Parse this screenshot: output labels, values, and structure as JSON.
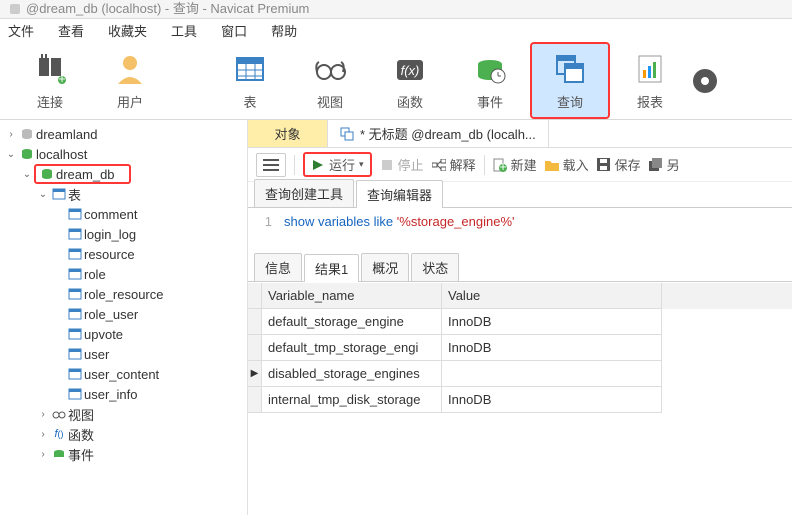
{
  "title_suffix": "@dream_db (localhost) - 查询 - Navicat Premium",
  "menubar": [
    "文件",
    "查看",
    "收藏夹",
    "工具",
    "窗口",
    "帮助"
  ],
  "toolbar": [
    {
      "label": "连接",
      "name": "toolbar-connection"
    },
    {
      "label": "用户",
      "name": "toolbar-user"
    },
    {
      "label": "表",
      "name": "toolbar-tables"
    },
    {
      "label": "视图",
      "name": "toolbar-views"
    },
    {
      "label": "函数",
      "name": "toolbar-functions"
    },
    {
      "label": "事件",
      "name": "toolbar-events"
    },
    {
      "label": "查询",
      "name": "toolbar-query",
      "highlighted": true
    },
    {
      "label": "报表",
      "name": "toolbar-reports"
    }
  ],
  "tree": {
    "conn1": "dreamland",
    "conn2": "localhost",
    "db": "dream_db",
    "tables_label": "表",
    "tables": [
      "comment",
      "login_log",
      "resource",
      "role",
      "role_resource",
      "role_user",
      "upvote",
      "user",
      "user_content",
      "user_info"
    ],
    "views": "视图",
    "functions": "函数",
    "events": "事件"
  },
  "tabs": {
    "objects": "对象",
    "query_title": "* 无标题 @dream_db (localh..."
  },
  "actions": {
    "run": "运行",
    "stop": "停止",
    "explain": "解释",
    "new": "新建",
    "load": "载入",
    "save": "保存",
    "saveas": "另"
  },
  "subtabs": {
    "builder": "查询创建工具",
    "editor": "查询编辑器"
  },
  "sql": {
    "line_no": "1",
    "kw1": "show",
    "kw2": "variables",
    "kw3": "like",
    "str": "'%storage_engine%'"
  },
  "result_tabs": [
    "信息",
    "结果1",
    "概况",
    "状态"
  ],
  "grid": {
    "headers": [
      "Variable_name",
      "Value"
    ],
    "rows": [
      {
        "c1": "default_storage_engine",
        "c2": "InnoDB",
        "cursor": false
      },
      {
        "c1": "default_tmp_storage_engi",
        "c2": "InnoDB",
        "cursor": false
      },
      {
        "c1": "disabled_storage_engines",
        "c2": "",
        "cursor": true
      },
      {
        "c1": "internal_tmp_disk_storage",
        "c2": "InnoDB",
        "cursor": false
      }
    ]
  },
  "colors": {
    "accent_red": "#ff3636",
    "run_green": "#2e7d32"
  }
}
